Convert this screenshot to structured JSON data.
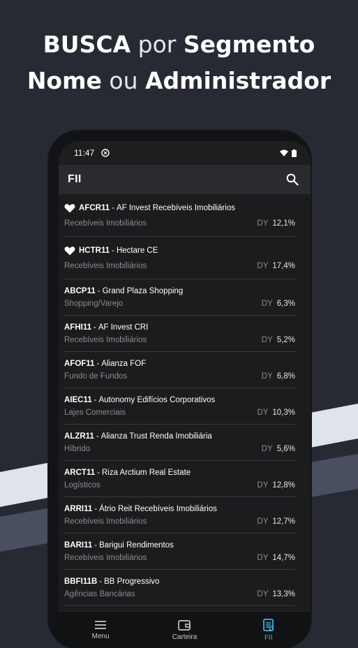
{
  "headline": {
    "line1_bold": "BUSCA",
    "line1_light": "por",
    "line1_bold2": "Segmento",
    "line2_bold": "Nome",
    "line2_light": "ou",
    "line2_bold2": "Administrador"
  },
  "statusbar": {
    "time": "11:47"
  },
  "appbar": {
    "title": "FII",
    "search_icon": "search-icon"
  },
  "colors": {
    "accent": "#3cb8e6",
    "background": "#272a33",
    "screen": "#1c1c1e"
  },
  "dy_label": "DY",
  "funds": [
    {
      "ticker": "AFCR11",
      "name": "AF Invest Recebíveis Imobiliários",
      "segment": "Recebíveis Imobiliários",
      "dy": "12,1%",
      "favorite": true
    },
    {
      "ticker": "HCTR11",
      "name": "Hectare CE",
      "segment": "Recebíveis Imobiliários",
      "dy": "17,4%",
      "favorite": true
    },
    {
      "ticker": "ABCP11",
      "name": "Grand Plaza Shopping",
      "segment": "Shopping/Varejo",
      "dy": "6,3%",
      "favorite": false
    },
    {
      "ticker": "AFHI11",
      "name": "AF Invest CRI",
      "segment": "Recebíveis Imobiliários",
      "dy": "5,2%",
      "favorite": false
    },
    {
      "ticker": "AFOF11",
      "name": "Alianza FOF",
      "segment": "Fundo de Fundos",
      "dy": "6,8%",
      "favorite": false
    },
    {
      "ticker": "AIEC11",
      "name": "Autonomy Edifícios Corporativos",
      "segment": "Lajes Comerciais",
      "dy": "10,3%",
      "favorite": false
    },
    {
      "ticker": "ALZR11",
      "name": "Alianza Trust Renda Imobiliária",
      "segment": "Híbrido",
      "dy": "5,6%",
      "favorite": false
    },
    {
      "ticker": "ARCT11",
      "name": "Riza Arctium Real Estate",
      "segment": "Logísticos",
      "dy": "12,8%",
      "favorite": false
    },
    {
      "ticker": "ARRI11",
      "name": "Átrio Reit Recebíveis Imobiliários",
      "segment": "Recebíveis Imobiliários",
      "dy": "12,7%",
      "favorite": false
    },
    {
      "ticker": "BARI11",
      "name": "Barigui Rendimentos",
      "segment": "Recebíveis Imobiliários",
      "dy": "14,7%",
      "favorite": false
    },
    {
      "ticker": "BBFI11B",
      "name": "BB Progressivo",
      "segment": "Agências Bancárias",
      "dy": "13,3%",
      "favorite": false
    }
  ],
  "nav": [
    {
      "label": "Menu",
      "icon": "menu-icon",
      "active": false
    },
    {
      "label": "Carteira",
      "icon": "wallet-icon",
      "active": false
    },
    {
      "label": "FII",
      "icon": "document-icon",
      "active": true
    }
  ]
}
